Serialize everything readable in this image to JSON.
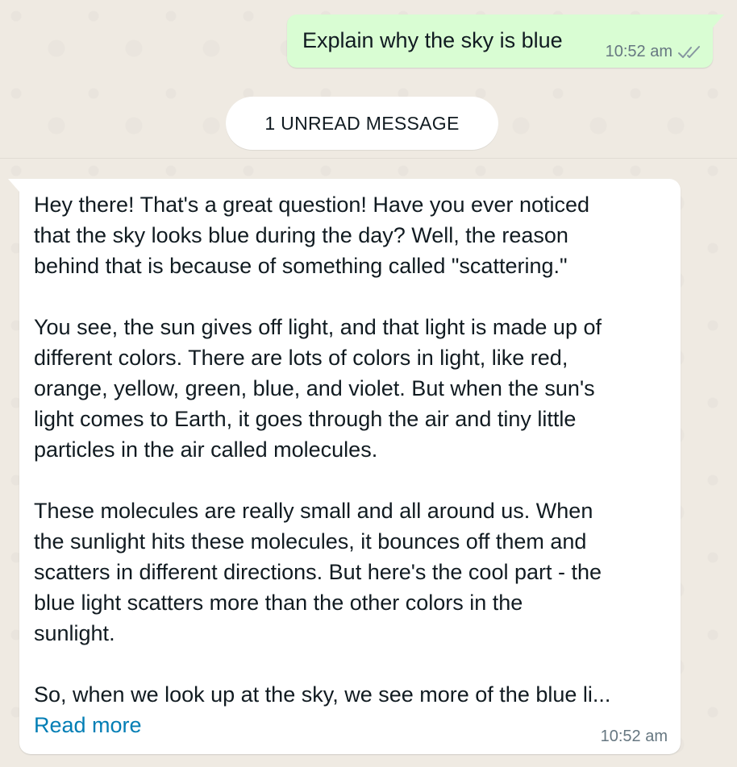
{
  "outgoing_message": {
    "text": "Explain why the sky is blue",
    "time": "10:52 am",
    "status_icon": "double-check-icon"
  },
  "unread_banner": {
    "label": "1 UNREAD MESSAGE"
  },
  "incoming_message": {
    "paragraphs": [
      "Hey there! That's a great question! Have you ever noticed\nthat the sky looks blue during the day? Well, the reason\nbehind that is because of something called \"scattering.\"",
      "You see, the sun gives off light, and that light is made up of\ndifferent colors. There are lots of colors in light, like red,\norange, yellow, green, blue, and violet. But when the sun's\nlight comes to Earth, it goes through the air and tiny little\nparticles in the air called molecules.",
      "These molecules are really small and all around us. When\nthe sunlight hits these molecules, it bounces off them and\nscatters in different directions. But here's the cool part - the\nblue light scatters more than the other colors in the\nsunlight.",
      "So, when we look up at the sky, we see more of the blue li..."
    ],
    "read_more_label": "Read more",
    "time": "10:52 am"
  },
  "colors": {
    "chat_background": "#efeae2",
    "outgoing_bubble": "#d9fdd3",
    "incoming_bubble": "#ffffff",
    "link": "#027eb5",
    "meta_text": "#667781"
  }
}
